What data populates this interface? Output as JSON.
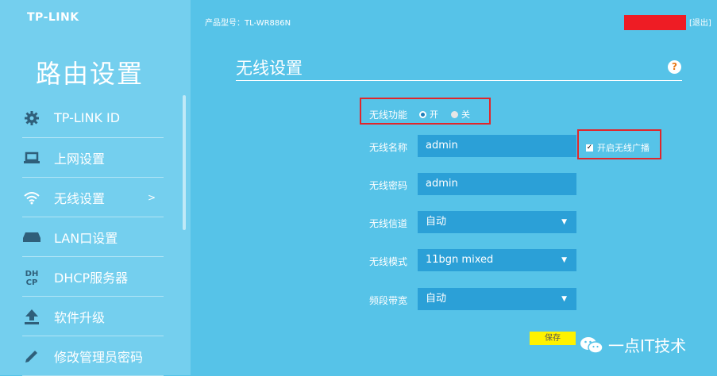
{
  "brand": "TP-LINK",
  "sidebar": {
    "title": "路由设置",
    "items": [
      {
        "label": "TP-LINK ID",
        "icon": "gear-icon"
      },
      {
        "label": "上网设置",
        "icon": "laptop-icon"
      },
      {
        "label": "无线设置",
        "icon": "wifi-icon",
        "arrow": ">"
      },
      {
        "label": "LAN口设置",
        "icon": "lan-icon"
      },
      {
        "label": "DHCP服务器",
        "icon": "dhcp-icon"
      },
      {
        "label": "软件升级",
        "icon": "upload-icon"
      },
      {
        "label": "修改管理员密码",
        "icon": "pencil-icon"
      }
    ]
  },
  "header": {
    "model": "产品型号：TL-WR886N",
    "logout": "[退出]"
  },
  "main": {
    "title": "无线设置",
    "help": "?",
    "wireless_function": {
      "label": "无线功能",
      "on": "开",
      "off": "关",
      "selected": "开"
    },
    "ssid": {
      "label": "无线名称",
      "value": "admin"
    },
    "broadcast": {
      "label": "开启无线广播",
      "checked": true
    },
    "password": {
      "label": "无线密码",
      "value": "admin"
    },
    "channel": {
      "label": "无线信道",
      "value": "自动"
    },
    "mode": {
      "label": "无线模式",
      "value": "11bgn mixed"
    },
    "bandwidth": {
      "label": "频段带宽",
      "value": "自动"
    },
    "save": "保存"
  },
  "watermark": "一点IT技术",
  "colors": {
    "background": "#56c3e8",
    "sidebar": "#74cfee",
    "field": "#2ba0d7",
    "highlight": "#e0262b",
    "save": "#fff200"
  }
}
